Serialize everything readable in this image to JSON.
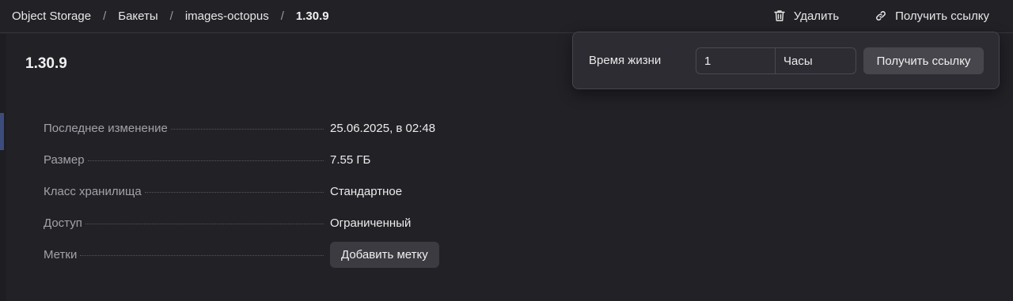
{
  "breadcrumb": {
    "items": [
      "Object Storage",
      "Бакеты",
      "images-octopus"
    ],
    "separator": "/",
    "current": "1.30.9"
  },
  "actions": {
    "delete_label": "Удалить",
    "delete_icon": "trash-icon",
    "get_link_label": "Получить ссылку",
    "get_link_icon": "link-icon"
  },
  "object": {
    "title": "1.30.9",
    "properties": [
      {
        "label": "Последнее изменение",
        "value": "25.06.2025, в 02:48"
      },
      {
        "label": "Размер",
        "value": "7.55 ГБ"
      },
      {
        "label": "Класс хранилища",
        "value": "Стандартное"
      },
      {
        "label": "Доступ",
        "value": "Ограниченный"
      },
      {
        "label": "Метки",
        "button_label": "Добавить метку"
      }
    ]
  },
  "link_popup": {
    "lifetime_label": "Время жизни",
    "lifetime_value": "1",
    "unit": "Часы",
    "submit_label": "Получить ссылку"
  },
  "colors": {
    "background": "#222126",
    "popup": "#2d2c32",
    "accent": "#3c4d7c"
  }
}
